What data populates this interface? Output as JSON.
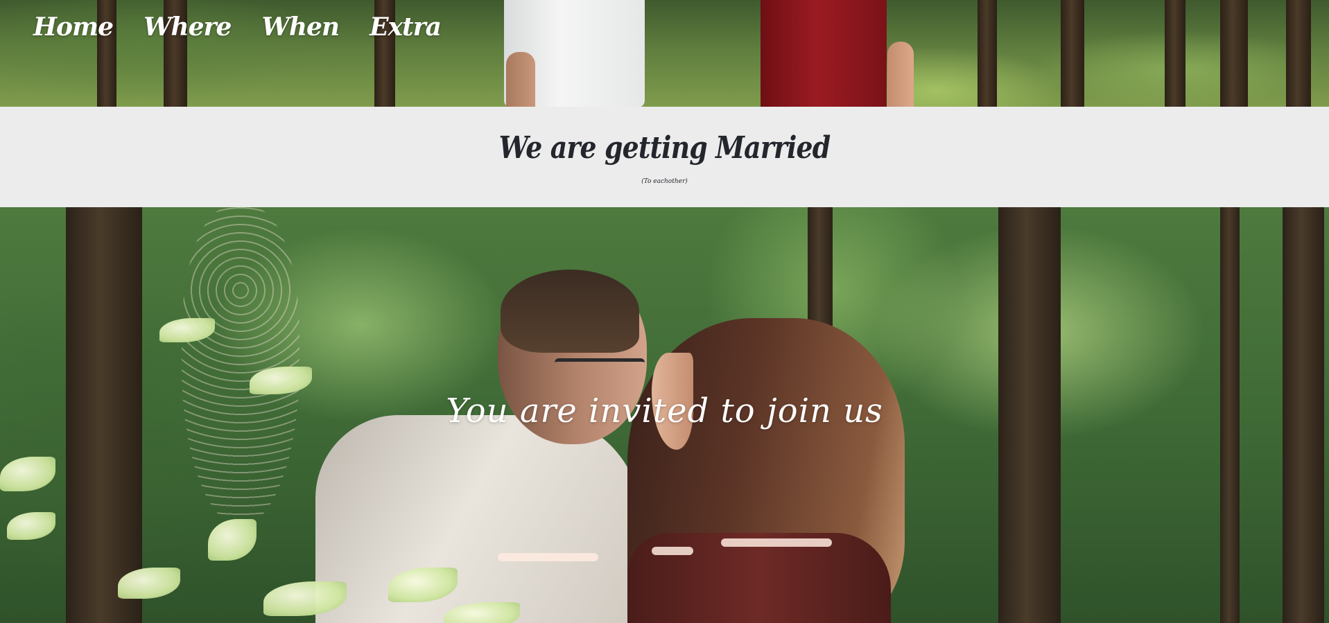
{
  "nav": {
    "items": [
      {
        "label": "Home"
      },
      {
        "label": "Where"
      },
      {
        "label": "When"
      },
      {
        "label": "Extra"
      }
    ]
  },
  "title_band": {
    "title": "We are getting Married",
    "subtitle": "(To eachother)"
  },
  "hero": {
    "invite_text": "You are invited to join us"
  },
  "colors": {
    "title_band_bg": "#ececec",
    "title_text": "#23262c",
    "nav_text": "#ffffff",
    "invite_text": "#ffffff"
  }
}
